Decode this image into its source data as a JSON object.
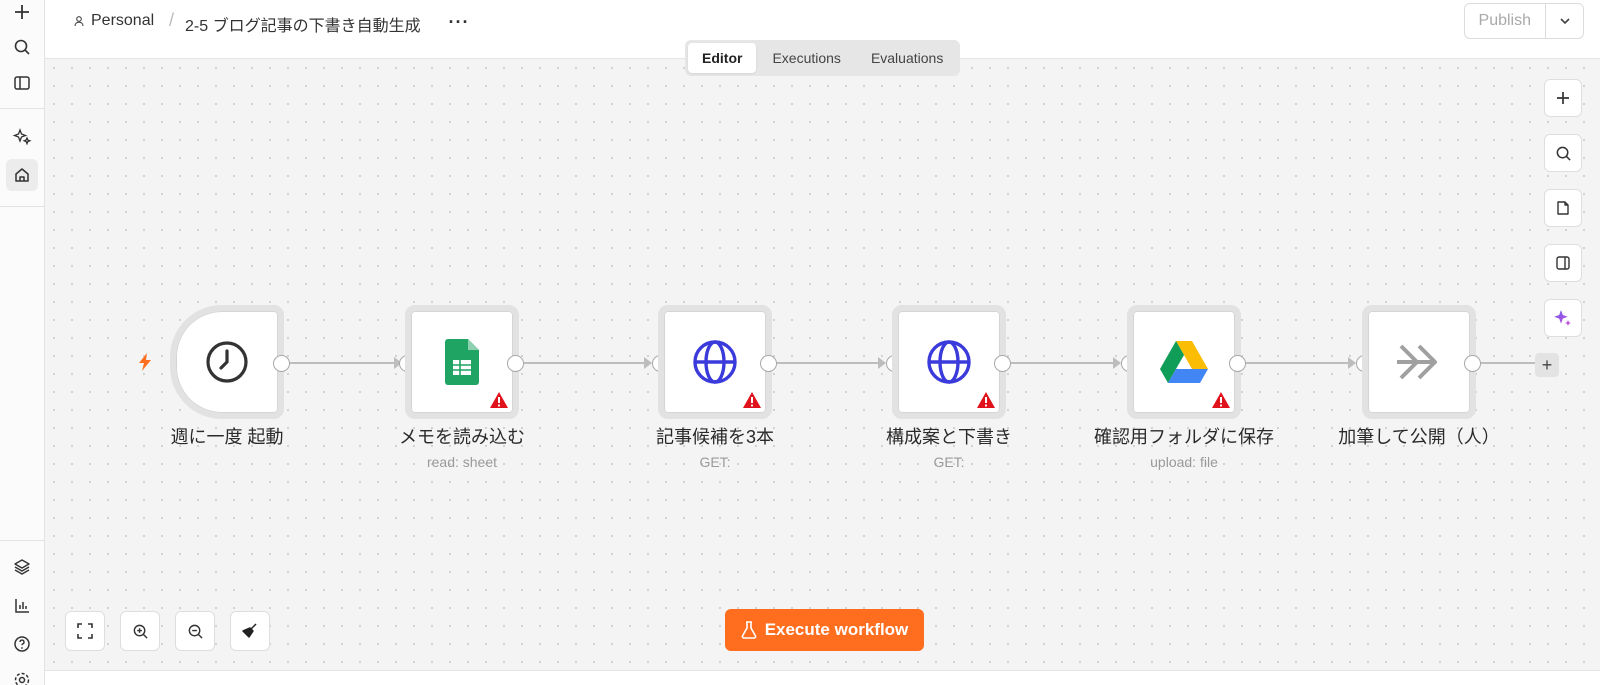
{
  "header": {
    "project_label": "Personal",
    "workflow_name": "2-5 ブログ記事の下書き自動生成",
    "more_label": "···",
    "publish_label": "Publish"
  },
  "tabs": [
    {
      "label": "Editor",
      "active": true
    },
    {
      "label": "Executions",
      "active": false
    },
    {
      "label": "Evaluations",
      "active": false
    }
  ],
  "nodes": [
    {
      "label": "週に一度 起動",
      "sub": "",
      "icon": "clock-icon"
    },
    {
      "label": "メモを読み込む",
      "sub": "read: sheet",
      "icon": "google-sheets-icon",
      "warning": true
    },
    {
      "label": "記事候補を3本",
      "sub": "GET:",
      "icon": "globe-icon",
      "warning": true
    },
    {
      "label": "構成案と下書き",
      "sub": "GET:",
      "icon": "globe-icon",
      "warning": true
    },
    {
      "label": "確認用フォルダに保存",
      "sub": "upload: file",
      "icon": "google-drive-icon",
      "warning": true
    },
    {
      "label": "加筆して公開（人）",
      "sub": "",
      "icon": "double-chevron-icon"
    }
  ],
  "execute_button": {
    "label": "Execute workflow"
  },
  "colors": {
    "accent": "#ff6d1f",
    "globe": "#3b3bdc",
    "warning": "#e0121b",
    "sheets": "#1fa463"
  }
}
